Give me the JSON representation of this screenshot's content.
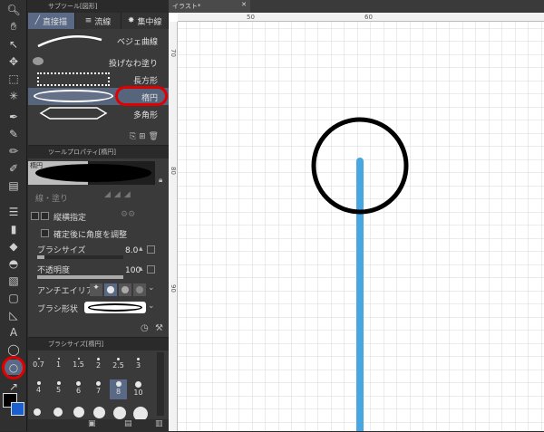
{
  "sub_tool_panel": {
    "header": "サブツール[図形]",
    "tabs": [
      {
        "label": "直接描",
        "active": true
      },
      {
        "label": "流線",
        "active": false
      },
      {
        "label": "集中線",
        "active": false
      }
    ],
    "items": [
      {
        "label": "ベジェ曲線",
        "selected": false
      },
      {
        "label": "投げなわ塗り",
        "selected": false
      },
      {
        "label": "長方形",
        "selected": false
      },
      {
        "label": "楕円",
        "selected": true
      },
      {
        "label": "多角形",
        "selected": false
      }
    ]
  },
  "tool_property_panel": {
    "header": "ツールプロパティ[楕円]",
    "preview_label": "楕円",
    "line_fill_label": "線・塗り",
    "aspect_label": "縦横指定",
    "adjust_angle_label": "確定後に角度を調整",
    "brush_size": {
      "label": "ブラシサイズ",
      "value": "8.0"
    },
    "opacity": {
      "label": "不透明度",
      "value": "100"
    },
    "antialias_label": "アンチエイリアス",
    "brush_shape_label": "ブラシ形状"
  },
  "brush_size_panel": {
    "header": "ブラシサイズ[楕円]",
    "row1": [
      "0.7",
      "1",
      "1.5",
      "2",
      "2.5",
      "3"
    ],
    "row2": [
      "4",
      "5",
      "6",
      "7",
      "8",
      "10"
    ]
  },
  "canvas": {
    "tab_label": "イラスト*",
    "ruler_top": [
      "50",
      "60"
    ],
    "ruler_left": [
      "70",
      "80",
      "90"
    ]
  },
  "colors": {
    "accent_selected": "#5a6a86",
    "highlight_ring": "#e00000",
    "stroke_blue": "#4aa6e0",
    "main_color": "#000000",
    "sub_color": "#1a5fd0"
  }
}
